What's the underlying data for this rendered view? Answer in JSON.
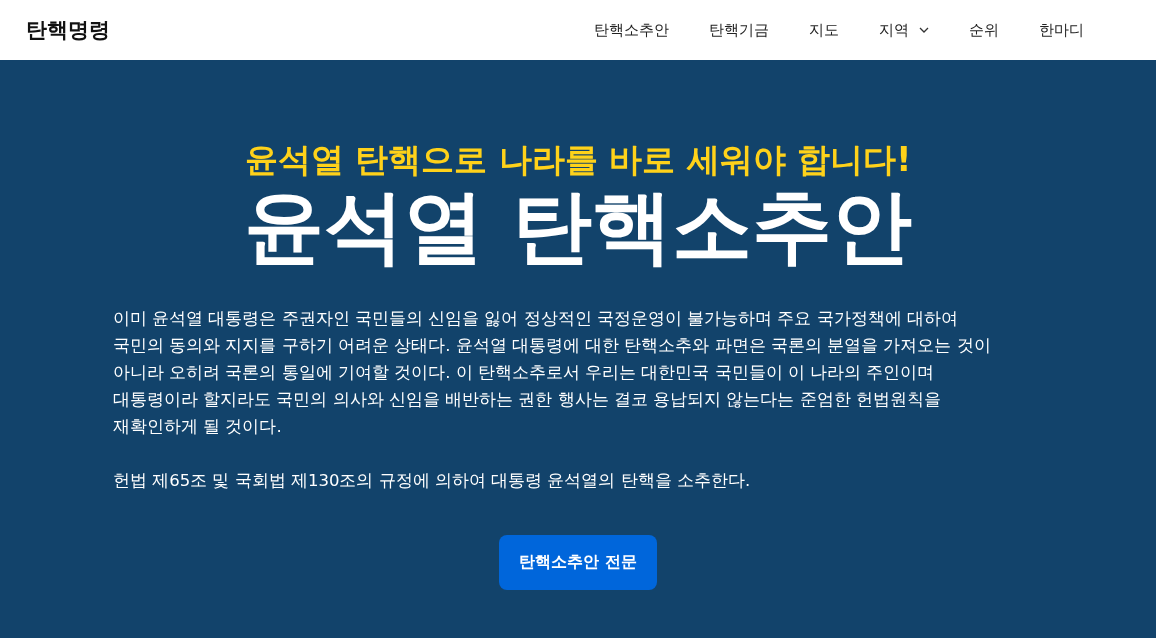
{
  "header": {
    "logo": "탄핵명령",
    "nav": [
      {
        "label": "탄핵소추안",
        "kind": "link"
      },
      {
        "label": "탄핵기금",
        "kind": "link"
      },
      {
        "label": "지도",
        "kind": "link"
      },
      {
        "label": "지역",
        "kind": "dropdown"
      },
      {
        "label": "순위",
        "kind": "link"
      },
      {
        "label": "한마디",
        "kind": "link"
      }
    ]
  },
  "hero": {
    "subtitle": "윤석열 탄핵으로 나라를 바로 세워야 합니다!",
    "title": "윤석열 탄핵소추안",
    "paragraphs": [
      [
        "이미 윤석열 대통령은 주권자인 국민들의 신임을 잃어 정상적인 국정운영이 불가능하며 주요 국가정책에 대하여",
        "국민의 동의와 지지를 구하기 어려운 상태다. 윤석열 대통령에 대한 탄핵소추와 파면은 국론의 분열을 가져오는 것이",
        "아니라 오히려 국론의 통일에 기여할 것이다. 이 탄핵소추로서 우리는 대한민국 국민들이 이 나라의 주인이며",
        "대통령이라 할지라도 국민의 의사와 신임을 배반하는 권한 행사는 결코 용납되지 않는다는 준엄한 헌법원칙을",
        "재확인하게 될 것이다."
      ],
      [
        "헌법 제65조 및 국회법 제130조의 규정에 의하여 대통령 윤석열의 탄핵을 소추한다."
      ]
    ],
    "button": "탄핵소추안 전문"
  }
}
